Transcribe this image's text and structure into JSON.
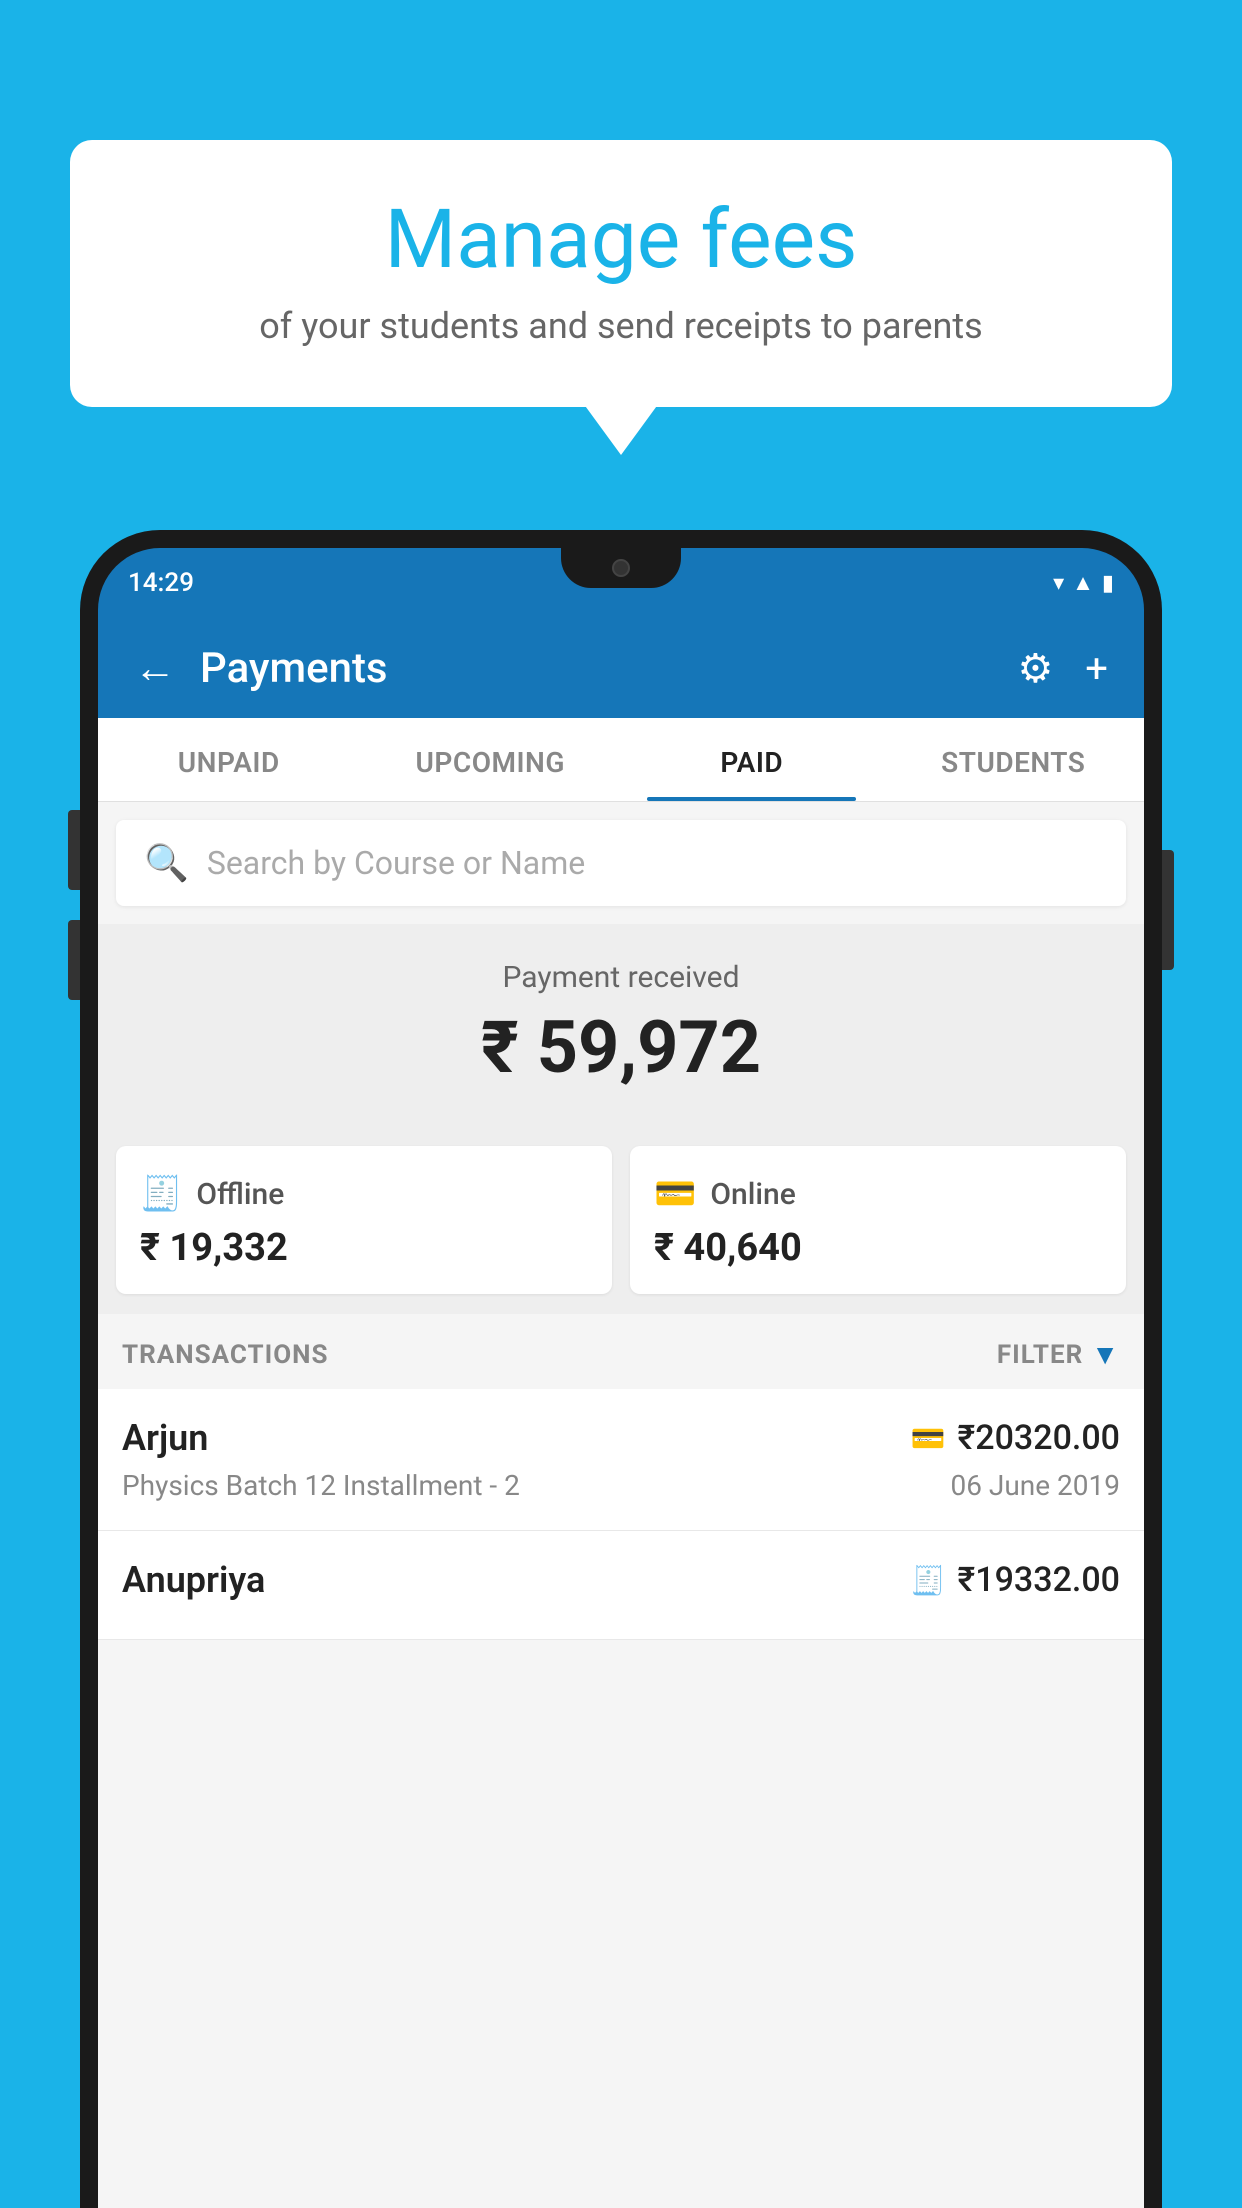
{
  "background_color": "#1ab3e8",
  "speech_bubble": {
    "title": "Manage fees",
    "subtitle": "of your students and send receipts to parents"
  },
  "phone": {
    "status_bar": {
      "time": "14:29"
    },
    "header": {
      "title": "Payments",
      "back_label": "←"
    },
    "tabs": [
      {
        "id": "unpaid",
        "label": "UNPAID",
        "active": false
      },
      {
        "id": "upcoming",
        "label": "UPCOMING",
        "active": false
      },
      {
        "id": "paid",
        "label": "PAID",
        "active": true
      },
      {
        "id": "students",
        "label": "STUDENTS",
        "active": false
      }
    ],
    "search": {
      "placeholder": "Search by Course or Name"
    },
    "payment_received": {
      "label": "Payment received",
      "amount": "₹ 59,972"
    },
    "payment_cards": [
      {
        "type": "Offline",
        "amount": "₹ 19,332",
        "icon": "offline"
      },
      {
        "type": "Online",
        "amount": "₹ 40,640",
        "icon": "online"
      }
    ],
    "transactions": {
      "section_label": "TRANSACTIONS",
      "filter_label": "FILTER",
      "items": [
        {
          "name": "Arjun",
          "detail": "Physics Batch 12 Installment - 2",
          "amount": "₹20320.00",
          "date": "06 June 2019",
          "icon": "card"
        },
        {
          "name": "Anupriya",
          "amount": "₹19332.00",
          "icon": "offline"
        }
      ]
    }
  }
}
